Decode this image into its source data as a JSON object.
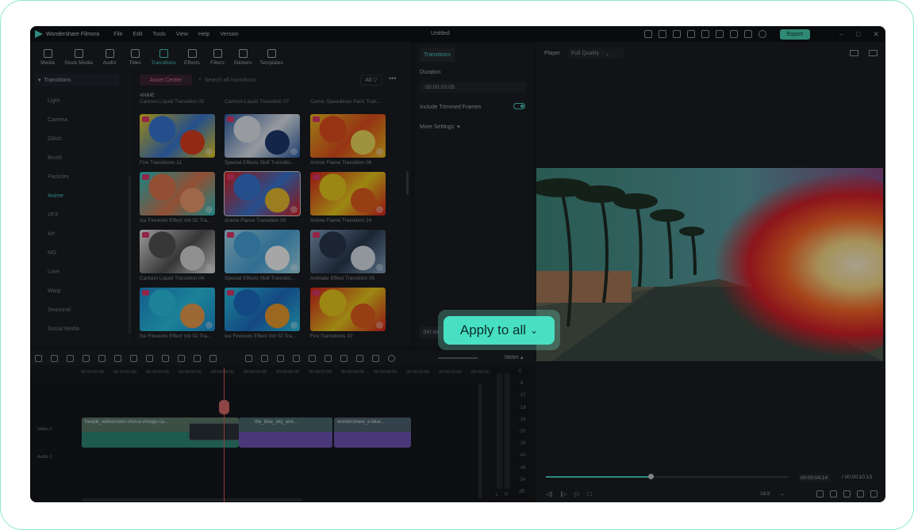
{
  "app": {
    "name": "Wondershare Filmora",
    "window_title": "Untitled",
    "export_label": "Export"
  },
  "menu": [
    "File",
    "Edit",
    "Tools",
    "View",
    "Help",
    "Version"
  ],
  "toolbar": [
    {
      "label": "Media",
      "icon": "media-icon"
    },
    {
      "label": "Stock Media",
      "icon": "stock-media-icon"
    },
    {
      "label": "Audio",
      "icon": "audio-icon"
    },
    {
      "label": "Titles",
      "icon": "titles-icon"
    },
    {
      "label": "Transitions",
      "icon": "transitions-icon",
      "active": true
    },
    {
      "label": "Effects",
      "icon": "effects-icon"
    },
    {
      "label": "Filters",
      "icon": "filters-icon"
    },
    {
      "label": "Stickers",
      "icon": "stickers-icon"
    },
    {
      "label": "Templates",
      "icon": "templates-icon"
    }
  ],
  "categories": {
    "header": "Transitions",
    "items": [
      "Light",
      "Camera",
      "Glitch",
      "Brush",
      "Particles",
      "Anime",
      "VFX",
      "Art",
      "MG",
      "Love",
      "Warp",
      "Seasonal",
      "Social Media"
    ],
    "active": "Anime"
  },
  "browser": {
    "asset_center": "Asset Center",
    "search_placeholder": "Search all transitions",
    "filter": "All",
    "section": "ANIME",
    "top_row": [
      "Cartoon Liquid Transition 05",
      "Cartoon Liquid Transition 07",
      "Comic Speedlines Pack Tran..."
    ],
    "items": [
      {
        "name": "Fire Transitions 11",
        "colors": [
          "#f0d020",
          "#3a7ad8",
          "#e04020"
        ]
      },
      {
        "name": "Special Effects Skill Transitio...",
        "colors": [
          "#2d5fa8",
          "#e8eef5",
          "#1e3a70"
        ]
      },
      {
        "name": "Anime Flame Transition 08",
        "colors": [
          "#f0c020",
          "#e85020",
          "#f5e060"
        ]
      },
      {
        "name": "Ice Firework Effect Vol 02 Tra...",
        "colors": [
          "#2bc8c8",
          "#e27a50",
          "#f1a070"
        ]
      },
      {
        "name": "Anime Flame Transition 05",
        "colors": [
          "#e02020",
          "#3a7ad8",
          "#f0c030"
        ]
      },
      {
        "name": "Anime Flame Transition 24",
        "colors": [
          "#e02020",
          "#f0d020",
          "#e86020"
        ]
      },
      {
        "name": "Cartoon Liquid Transition 04",
        "colors": [
          "#eeeeee",
          "#555555",
          "#dddddd"
        ]
      },
      {
        "name": "Special Effects Skill Transitio...",
        "colors": [
          "#a8e0f0",
          "#4aa8e0",
          "#ffffff"
        ]
      },
      {
        "name": "Animate Effect Transition 05",
        "colors": [
          "#8aa6c8",
          "#2a3a50",
          "#dde6ef"
        ]
      },
      {
        "name": "Ice Firework Effect Vol 02 Tra...",
        "colors": [
          "#1e90d8",
          "#2bc8e8",
          "#f0a050"
        ]
      },
      {
        "name": "Ice Firework Effect Vol 02 Tra...",
        "colors": [
          "#2bc8e8",
          "#1e70c8",
          "#f0a030"
        ]
      },
      {
        "name": "Fire Transitions 10",
        "colors": [
          "#e02020",
          "#f0d020",
          "#e86020"
        ]
      }
    ]
  },
  "properties": {
    "tab": "Transitions",
    "duration_label": "Duration",
    "duration_value": "00:00:03:05",
    "include_trimmed": "Include Trimmed Frames",
    "more_settings": "More Settings",
    "set_as": "Set as"
  },
  "player": {
    "label": "Player",
    "quality": "Full Quality",
    "current_time": "00:00:04:14",
    "total_time": "/  00:00:10:13",
    "ratio": "16:9",
    "progress": 0.43
  },
  "timeline": {
    "meter_label": "Meter",
    "ruler": [
      "00:00:00:00",
      "00:00:01:00",
      "00:00:02:00",
      "00:00:03:00",
      "00:00:04:00",
      "00:00:05:00",
      "00:00:06:00",
      "00:00:07:00",
      "00:00:08:00",
      "00:00:09:00",
      "00:00:10:00",
      "00:00:11:00",
      "00:00:12:00"
    ],
    "tracks": [
      "Video 1",
      "Audio 1"
    ],
    "clips": [
      "freepik_widescreen-shot-a-vintage-ca...",
      "the_blue_sky_and...",
      "wondershare_a-blue..."
    ],
    "meter_scale": [
      "0",
      "-6",
      "-12",
      "-18",
      "-24",
      "-30",
      "-36",
      "-42",
      "-48",
      "-54",
      "dB"
    ],
    "channels": [
      "L",
      "R"
    ]
  },
  "callout": {
    "label": "Apply to all"
  },
  "colors": {
    "accent": "#4bd3c8",
    "callout_bg": "#48e0c2",
    "frame_border": "#8de8d4"
  }
}
